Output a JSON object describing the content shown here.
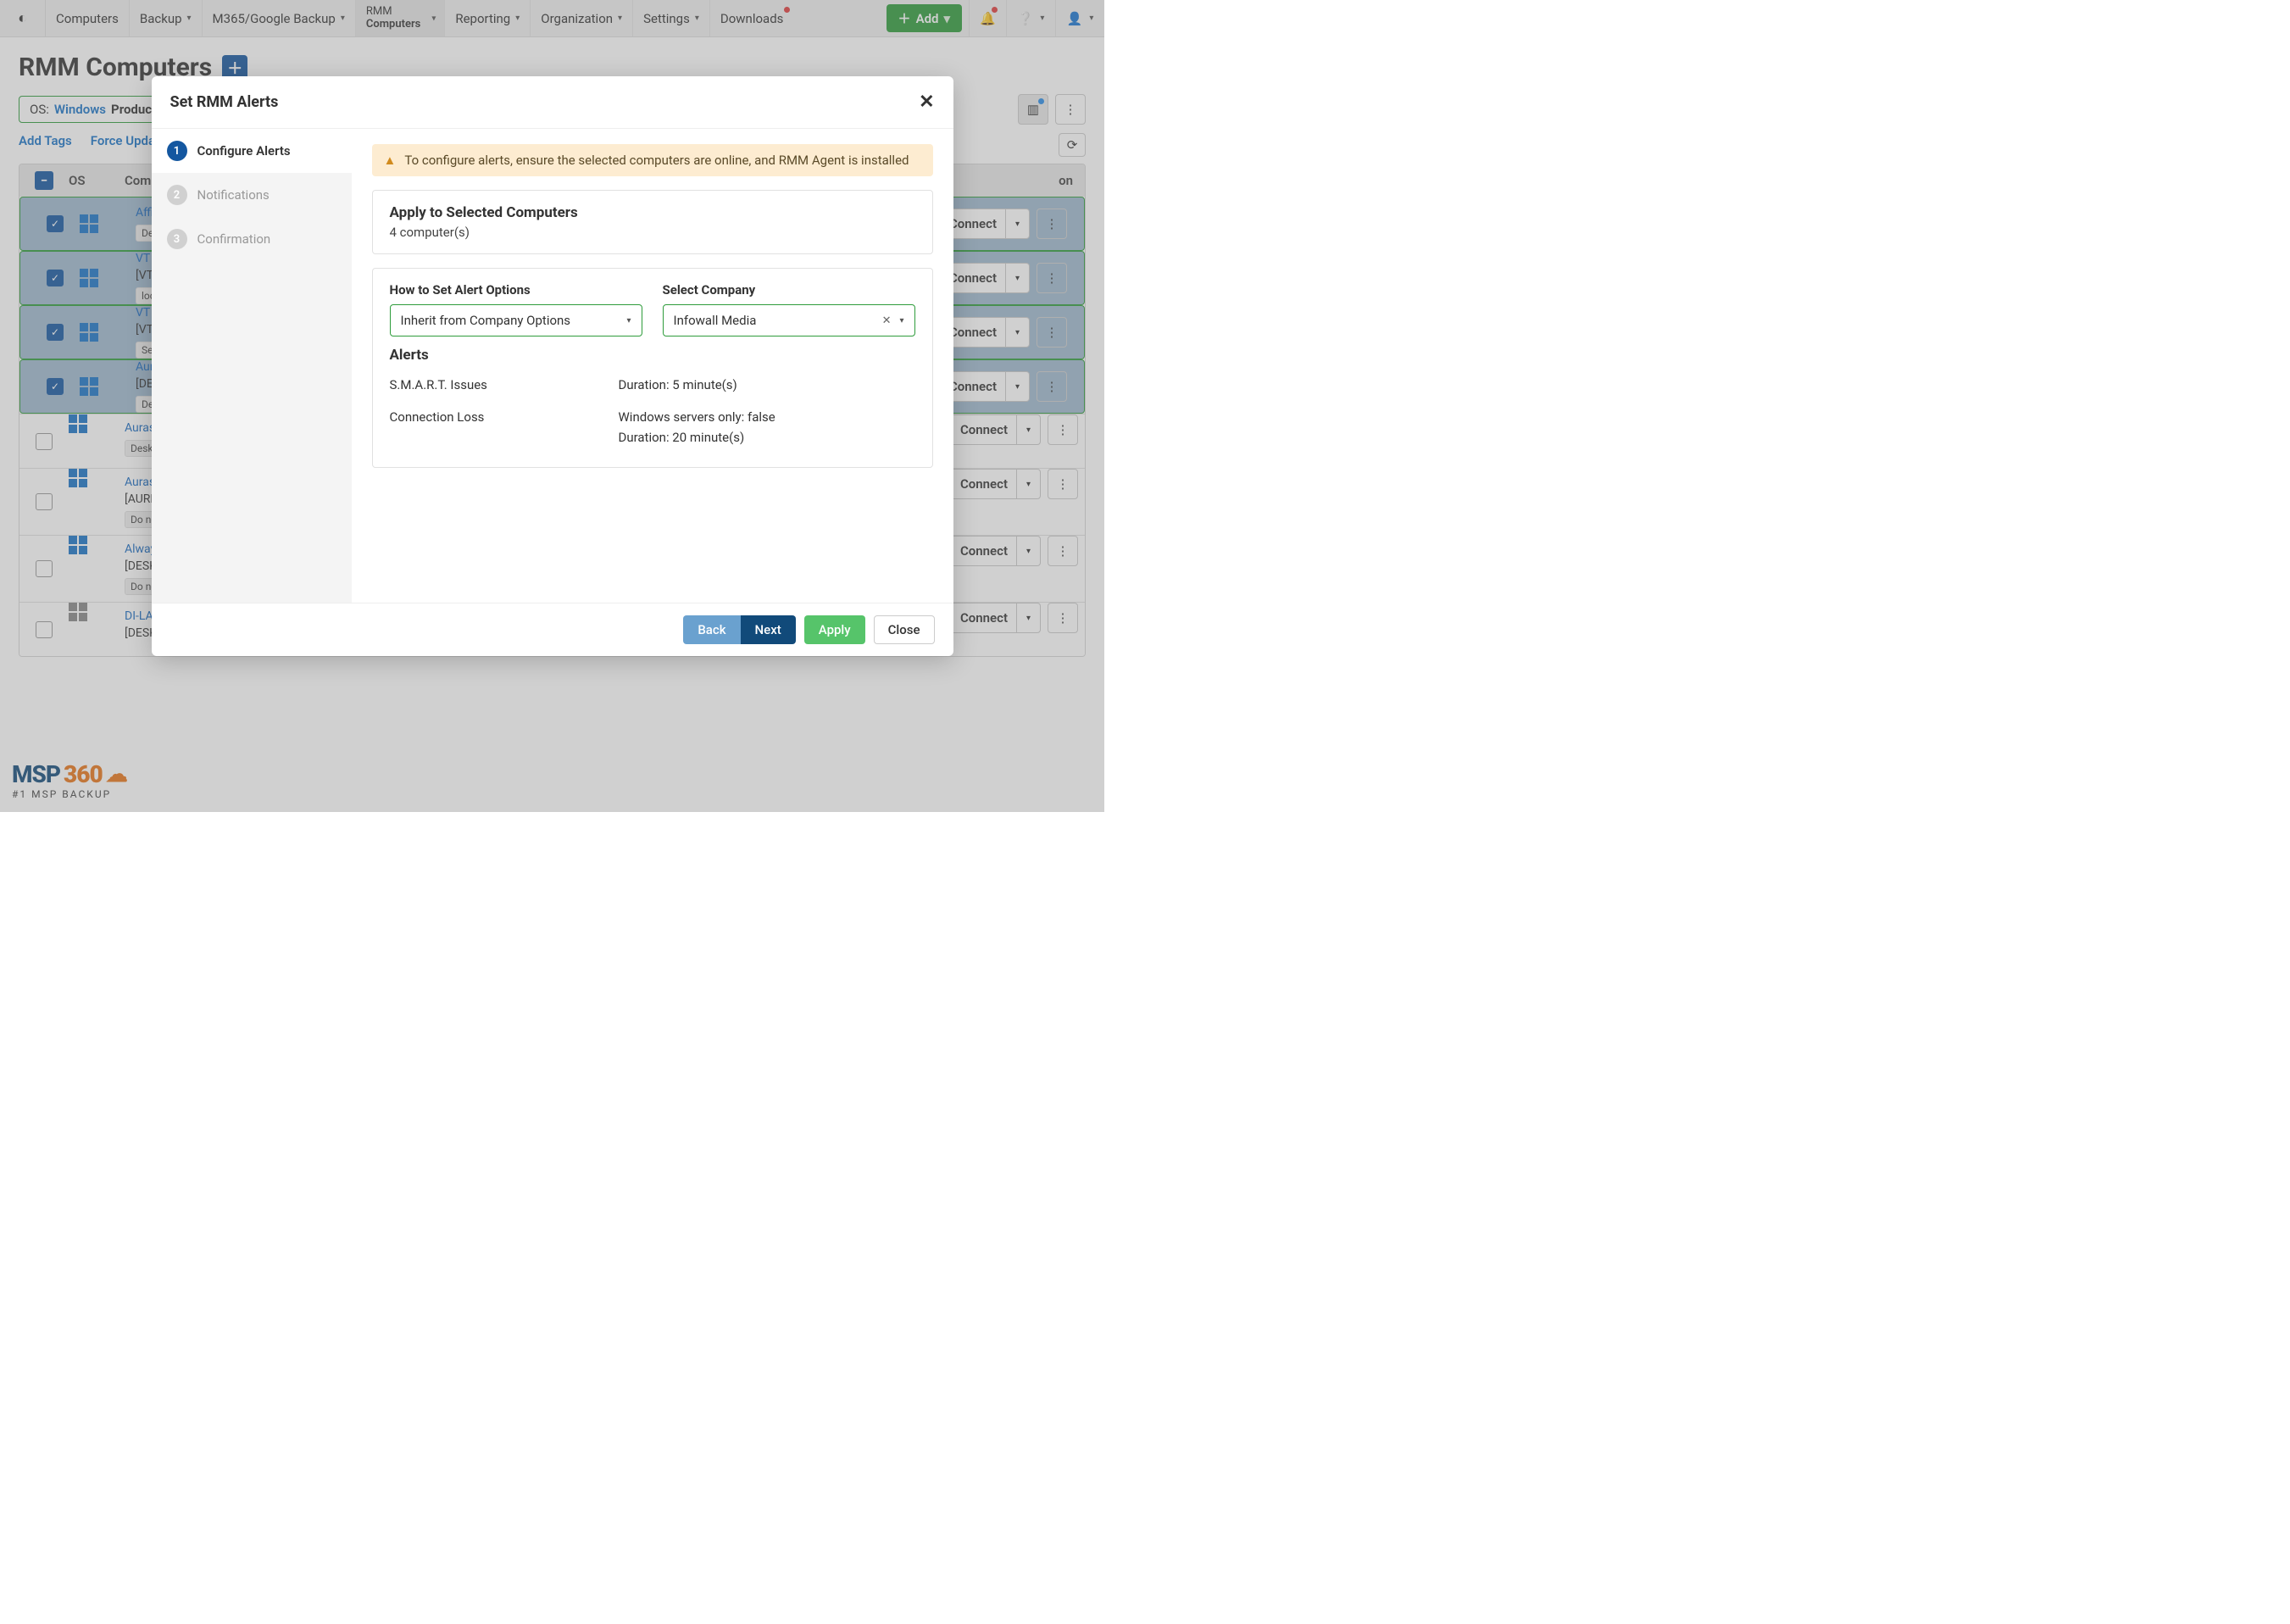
{
  "topnav": {
    "items": [
      "Computers",
      "Backup",
      "M365/Google Backup"
    ],
    "active_stack": {
      "line1": "RMM",
      "line2": "Computers"
    },
    "items2": [
      "Reporting",
      "Organization",
      "Settings",
      "Downloads"
    ],
    "add_label": "Add"
  },
  "page": {
    "title": "RMM Computers",
    "filter_os_key": "OS:",
    "filter_os_val": "Windows",
    "filter_prod_key": "Produc",
    "actions": {
      "add_tags": "Add Tags",
      "force_update": "Force Update"
    },
    "head": {
      "os": "OS",
      "comp": "Compu",
      "action": "on"
    }
  },
  "rows": [
    {
      "sel": true,
      "os": "win",
      "name": "AffiDe",
      "sub": "",
      "tag": "Deskt"
    },
    {
      "sel": true,
      "os": "win",
      "name": "VT AD",
      "sub": "[VTSer",
      "tag": "locatio"
    },
    {
      "sel": true,
      "os": "win",
      "name": "VT SQL",
      "sub": "[VTSer",
      "tag": "Serve"
    },
    {
      "sel": true,
      "os": "win",
      "name": "Aurasl",
      "sub": "[DESKT",
      "tag": "Deskt"
    },
    {
      "sel": false,
      "os": "win",
      "name": "Auras",
      "sub": "",
      "tag": "Deskt"
    },
    {
      "sel": false,
      "os": "win",
      "name": "Auras",
      "sub": "[AURH",
      "tag": "Do no"
    },
    {
      "sel": false,
      "os": "win",
      "name": "Always",
      "sub": "[DESKT",
      "tag": "Do no"
    },
    {
      "sel": false,
      "os": "wingrey",
      "name": "DI-LAE",
      "sub": "[DESKT",
      "tag": ""
    }
  ],
  "connect_label": "Connect",
  "modal": {
    "title": "Set RMM Alerts",
    "steps": [
      "Configure Alerts",
      "Notifications",
      "Confirmation"
    ],
    "warn": "To configure alerts, ensure the selected computers are online, and RMM Agent is installed",
    "apply_title": "Apply to Selected Computers",
    "apply_sub": "4 computer(s)",
    "how_label": "How to Set Alert Options",
    "how_value": "Inherit from Company Options",
    "company_label": "Select Company",
    "company_value": "Infowall Media",
    "alerts_head": "Alerts",
    "alerts": [
      {
        "name": "S.M.A.R.T. Issues",
        "details": [
          "Duration: 5 minute(s)"
        ]
      },
      {
        "name": "Connection Loss",
        "details": [
          "Windows servers only: false",
          "Duration: 20 minute(s)"
        ]
      }
    ],
    "buttons": {
      "back": "Back",
      "next": "Next",
      "apply": "Apply",
      "close": "Close"
    }
  },
  "footer": {
    "brand": "MSP360",
    "tag": "#1 MSP BACKUP"
  }
}
